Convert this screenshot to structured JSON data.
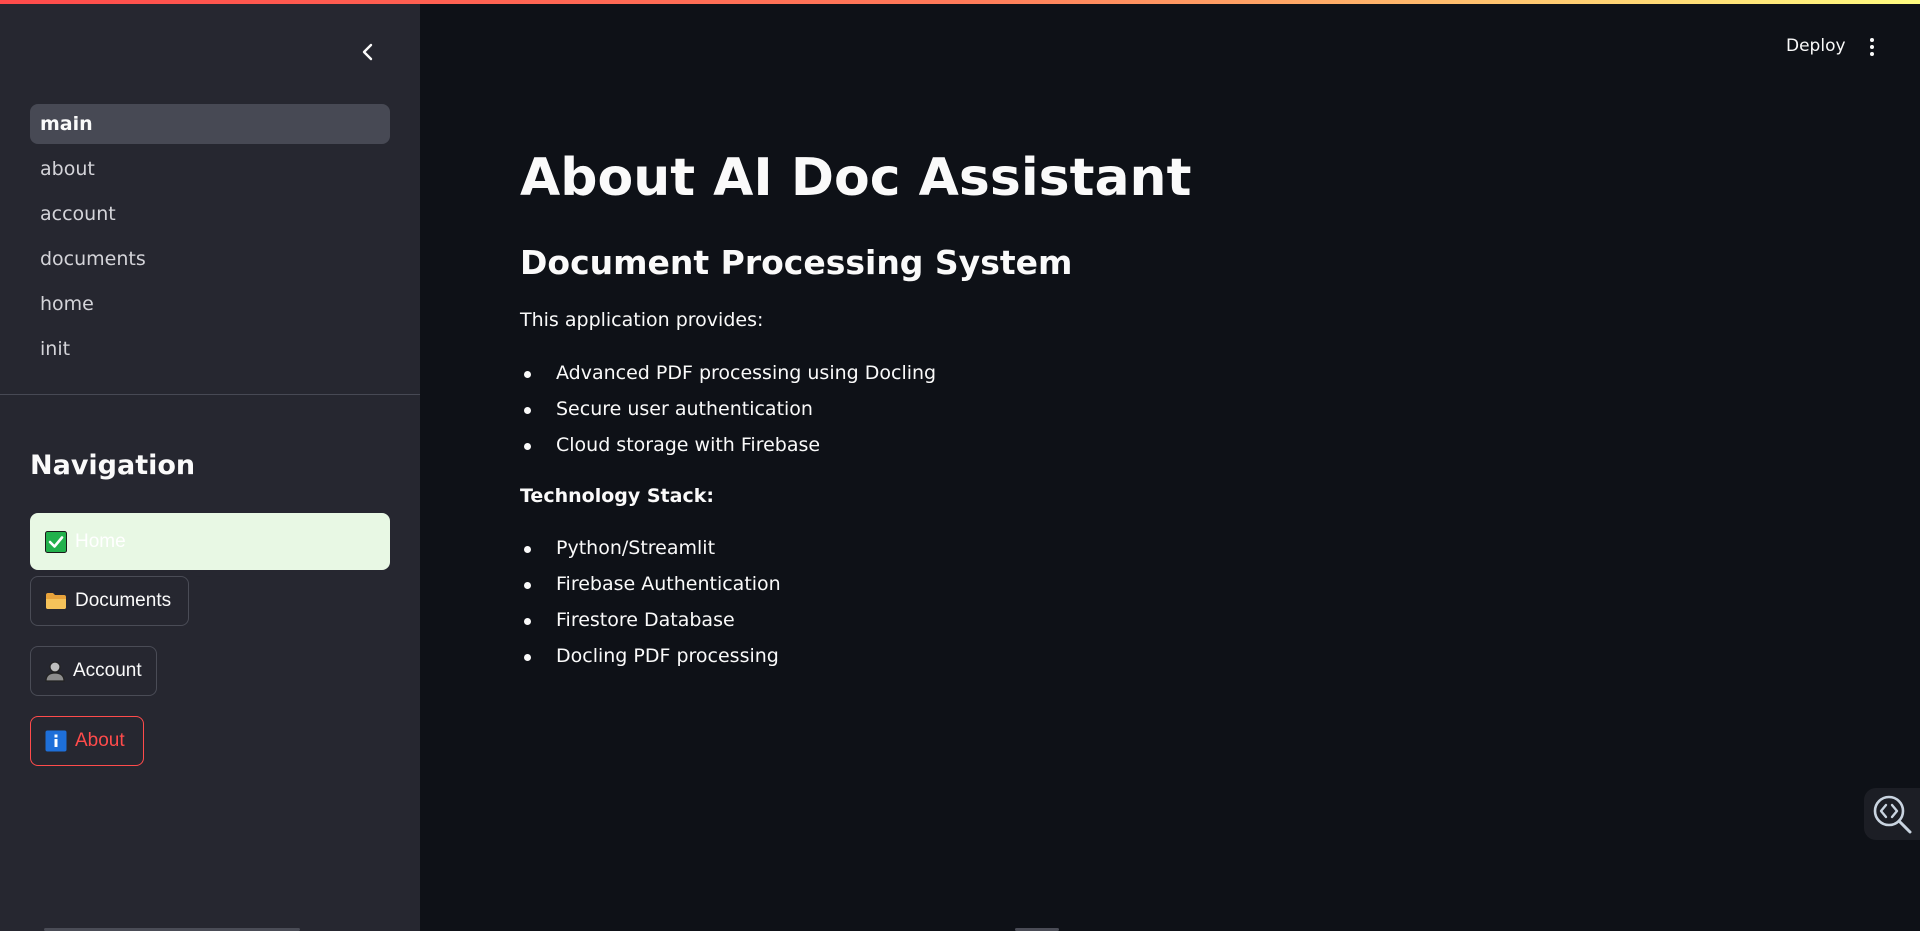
{
  "sidebar": {
    "pages": [
      {
        "label": "main",
        "active": true
      },
      {
        "label": "about",
        "active": false
      },
      {
        "label": "account",
        "active": false
      },
      {
        "label": "documents",
        "active": false
      },
      {
        "label": "home",
        "active": false
      },
      {
        "label": "init",
        "active": false
      }
    ],
    "nav_title": "Navigation",
    "nav_buttons": {
      "home": {
        "label": "Home",
        "icon": "check-mark-icon"
      },
      "documents": {
        "label": "Documents",
        "icon": "folder-icon"
      },
      "account": {
        "label": "Account",
        "icon": "user-icon"
      },
      "about": {
        "label": "About",
        "icon": "info-icon"
      }
    }
  },
  "header": {
    "deploy_label": "Deploy",
    "menu_icon": "vertical-dots-icon"
  },
  "main": {
    "title": "About AI Doc Assistant",
    "subtitle": "Document Processing System",
    "intro": "This application provides:",
    "features": [
      "Advanced PDF processing using Docling",
      "Secure user authentication",
      "Cloud storage with Firebase"
    ],
    "stack_heading": "Technology Stack:",
    "tech": [
      "Python/Streamlit",
      "Firebase Authentication",
      "Firestore Database",
      "Docling PDF processing"
    ]
  },
  "colors": {
    "accent": "#ff4b4b",
    "sidebar_bg": "#262730",
    "main_bg": "#0e1117",
    "active_page_bg": "#474954",
    "home_button_bg": "#e8f8e4"
  }
}
